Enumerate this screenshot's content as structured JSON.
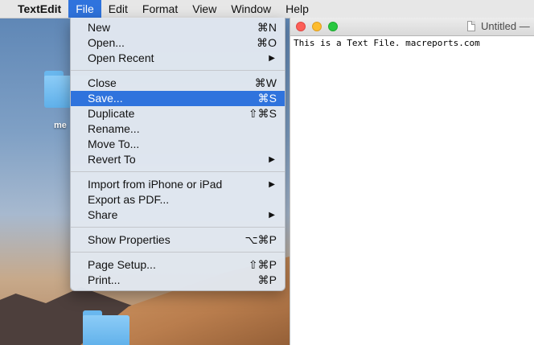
{
  "menubar": {
    "app": "TextEdit",
    "items": [
      "File",
      "Edit",
      "Format",
      "View",
      "Window",
      "Help"
    ],
    "active": "File"
  },
  "desktop": {
    "folder_label_partial": "me"
  },
  "file_menu": {
    "groups": [
      [
        {
          "label": "New",
          "shortcut": "⌘N"
        },
        {
          "label": "Open...",
          "shortcut": "⌘O"
        },
        {
          "label": "Open Recent",
          "submenu": true
        }
      ],
      [
        {
          "label": "Close",
          "shortcut": "⌘W"
        },
        {
          "label": "Save...",
          "shortcut": "⌘S",
          "highlighted": true
        },
        {
          "label": "Duplicate",
          "shortcut": "⇧⌘S"
        },
        {
          "label": "Rename..."
        },
        {
          "label": "Move To..."
        },
        {
          "label": "Revert To",
          "submenu": true
        }
      ],
      [
        {
          "label": "Import from iPhone or iPad",
          "submenu": true
        },
        {
          "label": "Export as PDF..."
        },
        {
          "label": "Share",
          "submenu": true
        }
      ],
      [
        {
          "label": "Show Properties",
          "shortcut": "⌥⌘P"
        }
      ],
      [
        {
          "label": "Page Setup...",
          "shortcut": "⇧⌘P"
        },
        {
          "label": "Print...",
          "shortcut": "⌘P"
        }
      ]
    ]
  },
  "window": {
    "title": "Untitled —",
    "content": "This is a Text File. macreports.com"
  },
  "colors": {
    "accent": "#2f73dd",
    "close": "#fc5f57",
    "minimize": "#fdbc2e",
    "zoom": "#28c840"
  }
}
